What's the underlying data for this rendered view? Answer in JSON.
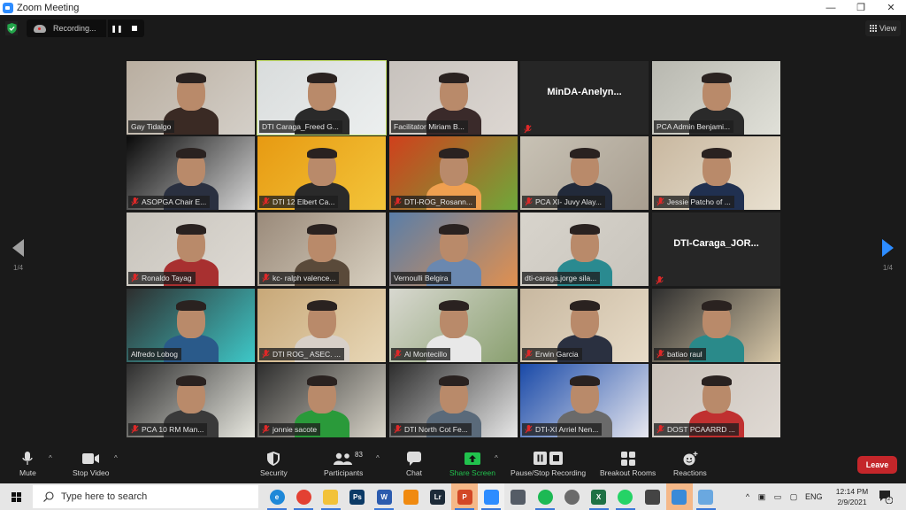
{
  "window": {
    "title": "Zoom Meeting",
    "controls": {
      "minimize": "—",
      "restore": "❐",
      "close": "✕"
    }
  },
  "topbar": {
    "security_icon": "shield-check-icon",
    "recording_label": "Recording...",
    "pause_icon": "pause-icon",
    "stop_icon": "stop-icon",
    "view_label": "View"
  },
  "pagination": {
    "left": "1/4",
    "right": "1/4"
  },
  "participants": [
    {
      "name": "Gay Tidalgo",
      "muted": false,
      "video": true,
      "speaking": false,
      "palette": [
        "#b9aea0",
        "#d4cfc8",
        "#3a2a24"
      ]
    },
    {
      "name": "DTI Caraga_Freed G...",
      "muted": false,
      "video": true,
      "speaking": true,
      "palette": [
        "#d9dcdc",
        "#ecefef",
        "#2a2a2a"
      ]
    },
    {
      "name": "Facilitator Miriam B...",
      "muted": false,
      "video": true,
      "speaking": false,
      "palette": [
        "#c7c2bd",
        "#ddd7d2",
        "#3a2a2a"
      ]
    },
    {
      "name": "MinDA-Anelyn...",
      "muted": true,
      "video": false,
      "speaking": false
    },
    {
      "name": "PCA Admin Benjami...",
      "muted": false,
      "video": true,
      "speaking": false,
      "palette": [
        "#b8b8b0",
        "#e0e0d8",
        "#2a2a2a"
      ]
    },
    {
      "name": "ASOPGA Chair E...",
      "muted": true,
      "video": true,
      "speaking": false,
      "palette": [
        "#0a0a0a",
        "#d8d8d8",
        "#2a3040"
      ]
    },
    {
      "name": "DTI 12 Elbert Ca...",
      "muted": true,
      "video": true,
      "speaking": false,
      "palette": [
        "#e79a12",
        "#f3c53a",
        "#2a2a2a"
      ]
    },
    {
      "name": "DTI-ROG_Rosann...",
      "muted": true,
      "video": true,
      "speaking": false,
      "palette": [
        "#d0401c",
        "#6fa83a",
        "#f0a050"
      ]
    },
    {
      "name": "PCA XI- Juvy Alay...",
      "muted": true,
      "video": true,
      "speaking": false,
      "palette": [
        "#c8c2b5",
        "#a89e90",
        "#222a3a"
      ]
    },
    {
      "name": "Jessie Patcho of ...",
      "muted": true,
      "video": true,
      "speaking": false,
      "palette": [
        "#c9b8a0",
        "#e8e0d0",
        "#203050"
      ]
    },
    {
      "name": "Ronaldo Tayag",
      "muted": true,
      "video": true,
      "speaking": false,
      "palette": [
        "#c8c4bc",
        "#dedad4",
        "#a83030"
      ]
    },
    {
      "name": "kc- ralph valence...",
      "muted": true,
      "video": true,
      "speaking": false,
      "palette": [
        "#9a8a7a",
        "#d8d0c0",
        "#5a4a3a"
      ]
    },
    {
      "name": "Vernoulli Belgira",
      "muted": false,
      "video": true,
      "speaking": false,
      "palette": [
        "#5a7ea8",
        "#e09050",
        "#6a88b0"
      ]
    },
    {
      "name": "dti-caraga.jorge sila...",
      "muted": false,
      "video": true,
      "speaking": false,
      "palette": [
        "#d8d4cc",
        "#c8c4bc",
        "#2a8a90"
      ]
    },
    {
      "name": "DTI-Caraga_JOR...",
      "muted": true,
      "video": false,
      "speaking": false
    },
    {
      "name": "Alfredo Lobog",
      "muted": false,
      "video": true,
      "speaking": false,
      "palette": [
        "#2e2e2e",
        "#3ec8c8",
        "#2a5a8a"
      ]
    },
    {
      "name": "DTI ROG_ ASEC. ...",
      "muted": true,
      "video": true,
      "speaking": false,
      "palette": [
        "#c8a878",
        "#e8d8b8",
        "#d8d0c8"
      ]
    },
    {
      "name": "Al Montecillo",
      "muted": true,
      "video": true,
      "speaking": false,
      "palette": [
        "#d8d8d0",
        "#8aa070",
        "#e8e8e8"
      ]
    },
    {
      "name": "Erwin Garcia",
      "muted": true,
      "video": true,
      "speaking": false,
      "palette": [
        "#c8b8a0",
        "#e8dcc8",
        "#2a3040"
      ]
    },
    {
      "name": "batiao raul",
      "muted": true,
      "video": true,
      "speaking": false,
      "palette": [
        "#2e2e2e",
        "#d8c8a8",
        "#2a8a8a"
      ]
    },
    {
      "name": "PCA 10 RM Man...",
      "muted": true,
      "video": true,
      "speaking": false,
      "palette": [
        "#2e2e2e",
        "#e8e8e0",
        "#3a3a3a"
      ]
    },
    {
      "name": "jonnie sacote",
      "muted": true,
      "video": true,
      "speaking": false,
      "palette": [
        "#2e2e2e",
        "#d8d4c8",
        "#2a9a3a"
      ]
    },
    {
      "name": "DTI North Cot Fe...",
      "muted": true,
      "video": true,
      "speaking": false,
      "palette": [
        "#2e2e2e",
        "#e8e8e8",
        "#5a6a7a"
      ]
    },
    {
      "name": "DTI-XI Arriel Nen...",
      "muted": true,
      "video": true,
      "speaking": false,
      "palette": [
        "#1a4aa8",
        "#e8e8f0",
        "#6a6a6a"
      ]
    },
    {
      "name": "DOST PCAARRD ...",
      "muted": true,
      "video": true,
      "speaking": false,
      "palette": [
        "#c8c0b8",
        "#e0dad4",
        "#c03030"
      ]
    }
  ],
  "toolbar": {
    "mute": "Mute",
    "stop_video": "Stop Video",
    "security": "Security",
    "participants": "Participants",
    "participants_count": "83",
    "chat": "Chat",
    "share_screen": "Share Screen",
    "pause_stop_recording": "Pause/Stop Recording",
    "breakout_rooms": "Breakout Rooms",
    "reactions": "Reactions",
    "leave": "Leave",
    "caret": "^"
  },
  "taskbar": {
    "search_placeholder": "Type here to search",
    "apps": [
      {
        "name": "edge",
        "label": "e",
        "color": "#1e88d8"
      },
      {
        "name": "chrome",
        "label": "",
        "color": "#e34133"
      },
      {
        "name": "file-explorer",
        "label": "",
        "color": "#f2c23a"
      },
      {
        "name": "photoshop",
        "label": "Ps",
        "color": "#0b3a66"
      },
      {
        "name": "word",
        "label": "W",
        "color": "#2b5bae"
      },
      {
        "name": "vlc",
        "label": "",
        "color": "#f08a10"
      },
      {
        "name": "lightroom",
        "label": "Lr",
        "color": "#1c2a38"
      },
      {
        "name": "powerpoint",
        "label": "P",
        "color": "#d24726"
      },
      {
        "name": "zoom",
        "label": "",
        "color": "#2d8cff"
      },
      {
        "name": "calculator",
        "label": "",
        "color": "#555c66"
      },
      {
        "name": "spotify",
        "label": "",
        "color": "#1db954"
      },
      {
        "name": "camera",
        "label": "",
        "color": "#6a6a6a"
      },
      {
        "name": "excel",
        "label": "X",
        "color": "#1e7145"
      },
      {
        "name": "whatsapp",
        "label": "",
        "color": "#25d366"
      },
      {
        "name": "printer",
        "label": "",
        "color": "#444444"
      },
      {
        "name": "people-app",
        "label": "",
        "color": "#3a8ad8"
      },
      {
        "name": "paint",
        "label": "",
        "color": "#6aa8e0"
      }
    ],
    "language": "ENG",
    "time": "12:14 PM",
    "date": "2/9/2021",
    "notification_count": "2"
  }
}
